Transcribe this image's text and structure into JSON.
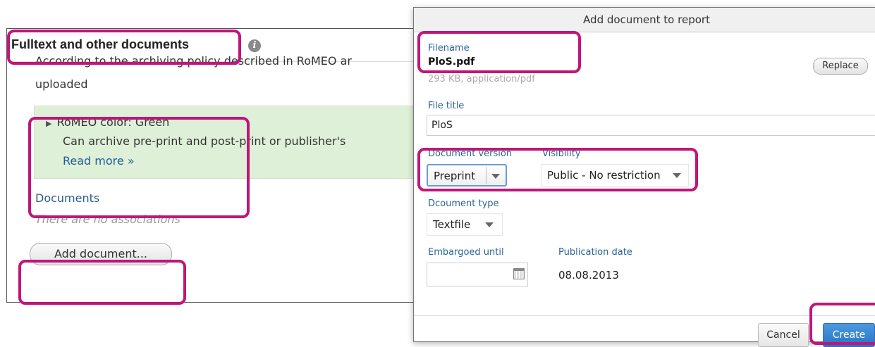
{
  "panel": {
    "title": "Fulltext and other documents",
    "info_icon": "info-icon",
    "policy_text_line1": "According to the archiving policy described in RoMEO ar",
    "policy_text_line2": "uploaded",
    "romeo": {
      "color_label": "RoMEO color: Green",
      "archive_text": "Can archive pre-print and post-print or publisher's",
      "read_more": "Read more »"
    },
    "documents_label": "Documents",
    "no_associations": "There are no associations",
    "add_document_button": "Add document..."
  },
  "modal": {
    "title": "Add document to report",
    "filename_label": "Filename",
    "filename": "PloS.pdf",
    "file_meta": "293 KB, application/pdf",
    "replace_button": "Replace",
    "file_title_label": "File title",
    "file_title_value": "PloS",
    "document_version_label": "Document version",
    "document_version_value": "Preprint",
    "visibility_label": "Visibility",
    "visibility_value": "Public - No restriction",
    "document_type_label": "Dcoument type",
    "document_type_value": "Textfile",
    "embargoed_label": "Embargoed until",
    "embargoed_value": "",
    "publication_date_label": "Publication date",
    "publication_date_value": "08.08.2013",
    "cancel_button": "Cancel",
    "create_button": "Create"
  },
  "colors": {
    "highlight": "#c0157a",
    "green_box": "#dff0d8",
    "primary_button": "#2a73c4"
  }
}
